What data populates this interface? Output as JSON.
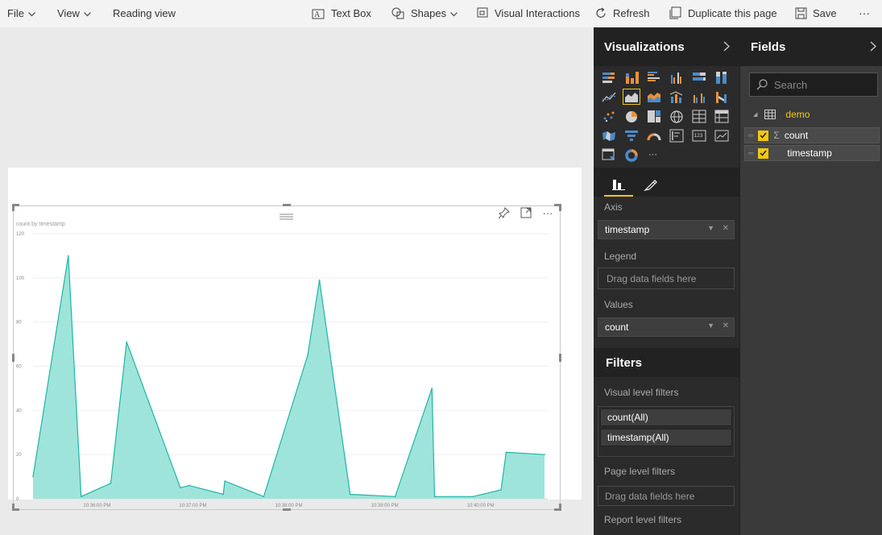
{
  "toolbar": {
    "file": "File",
    "view": "View",
    "reading_view": "Reading view",
    "text_box": "Text Box",
    "shapes": "Shapes",
    "visual_interactions": "Visual Interactions",
    "refresh": "Refresh",
    "duplicate": "Duplicate this page",
    "save": "Save",
    "more": "···"
  },
  "visual": {
    "title": "count by timestamp",
    "accent_color": "#99e3d9",
    "line_color": "#1fb5a5"
  },
  "chart_data": {
    "type": "area",
    "title": "count by timestamp",
    "xlabel": "",
    "ylabel": "",
    "ylim": [
      0,
      120
    ],
    "yticks": [
      0,
      20,
      40,
      60,
      80,
      100,
      120
    ],
    "xtick_labels": [
      "10:36:00 PM",
      "10:37:00 PM",
      "10:38:00 PM",
      "10:39:00 PM",
      "10:40:00 PM"
    ],
    "xtick_positions": [
      0.125,
      0.3125,
      0.5,
      0.6875,
      0.875
    ],
    "x": [
      0.0,
      0.069,
      0.094,
      0.152,
      0.183,
      0.288,
      0.305,
      0.372,
      0.375,
      0.451,
      0.537,
      0.56,
      0.62,
      0.708,
      0.78,
      0.785,
      0.86,
      0.915,
      0.925,
      1.0
    ],
    "values": [
      10,
      110,
      1,
      7,
      71,
      5,
      6,
      2,
      8,
      1,
      65,
      99,
      2,
      1,
      50,
      1,
      1,
      4,
      21,
      20
    ],
    "grid": true
  },
  "visualizations": {
    "title": "Visualizations",
    "icons": [
      "stacked-bar-icon",
      "stacked-column-icon",
      "clustered-bar-icon",
      "clustered-column-icon",
      "100-stacked-bar-icon",
      "100-stacked-column-icon",
      "line-chart-icon",
      "area-chart-icon",
      "stacked-area-icon",
      "line-column-icon",
      "line-clustered-column-icon",
      "ribbon-chart-icon",
      "scatter-icon",
      "pie-icon",
      "treemap-icon",
      "globe-map-icon",
      "table-icon",
      "matrix-icon",
      "filled-map-icon",
      "funnel-icon",
      "gauge-icon",
      "multirow-card-icon",
      "card-icon",
      "kpi-icon",
      "slicer-icon",
      "donut-icon",
      "more-visuals-icon"
    ],
    "wells": {
      "axis_label": "Axis",
      "axis_value": "timestamp",
      "legend_label": "Legend",
      "legend_placeholder": "Drag data fields here",
      "values_label": "Values",
      "values_value": "count"
    }
  },
  "filters": {
    "title": "Filters",
    "visual_level": "Visual level filters",
    "items": [
      "count(All)",
      "timestamp(All)"
    ],
    "page_level": "Page level filters",
    "page_placeholder": "Drag data fields here",
    "report_level": "Report level filters"
  },
  "fields": {
    "title": "Fields",
    "search_placeholder": "Search",
    "table": "demo",
    "field_items": [
      "count",
      "timestamp"
    ]
  }
}
